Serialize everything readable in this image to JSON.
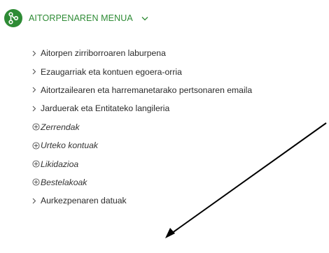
{
  "header": {
    "title": "AITORPENAREN MENUA",
    "icon": "branch-icon",
    "chevron_icon": "chevron-down-icon",
    "accent_color": "#2e8b35"
  },
  "menu": {
    "items": [
      {
        "label": "Aitorpen zirriborroaren laburpena",
        "kind": "link"
      },
      {
        "label": "Ezaugarriak eta kontuen egoera-orria",
        "kind": "link"
      },
      {
        "label": "Aitortzailearen eta harremanetarako pertsonaren emaila",
        "kind": "link"
      },
      {
        "label": "Jarduerak eta Entitateko langileria",
        "kind": "link"
      },
      {
        "label": "Zerrendak",
        "kind": "group"
      },
      {
        "label": "Urteko kontuak",
        "kind": "group"
      },
      {
        "label": "Likidazioa",
        "kind": "group"
      },
      {
        "label": "Bestelakoak",
        "kind": "group"
      },
      {
        "label": "Aurkezpenaren datuak",
        "kind": "link"
      }
    ]
  }
}
